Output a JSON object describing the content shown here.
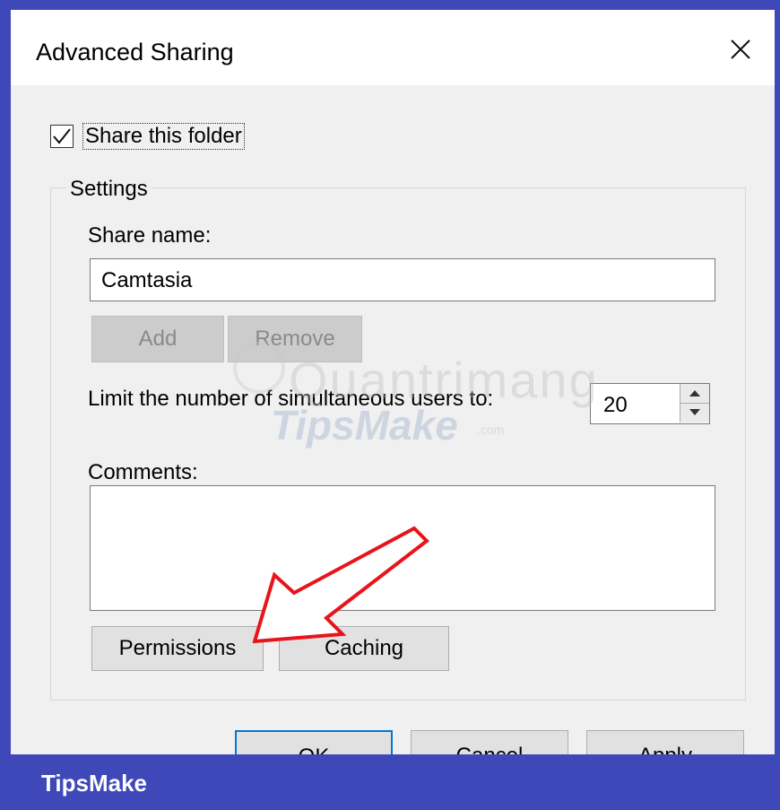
{
  "dialog": {
    "title": "Advanced Sharing",
    "share_checkbox": {
      "label": "Share this folder",
      "checked": true
    },
    "settings": {
      "legend": "Settings",
      "share_name_label": "Share name:",
      "share_name_value": "Camtasia",
      "add_button": "Add",
      "remove_button": "Remove",
      "limit_label": "Limit the number of simultaneous users to:",
      "limit_value": "20",
      "comments_label": "Comments:",
      "comments_value": "",
      "permissions_button": "Permissions",
      "caching_button": "Caching"
    },
    "footer_buttons": {
      "ok": "OK",
      "cancel": "Cancel",
      "apply": "Apply"
    }
  },
  "watermark": {
    "line1": "Quantrimang",
    "line2": "TipsMake",
    "suffix": ".com"
  },
  "footer_banner": {
    "text": "TipsMake"
  },
  "icons": {
    "close": "close-icon",
    "checkmark": "checkmark-icon",
    "annotation": "red-arrow-icon"
  },
  "colors": {
    "frame": "#3f48b8",
    "dialog_bg": "#f0f0f0",
    "accent": "#0078d7",
    "arrow": "#e8141c"
  }
}
